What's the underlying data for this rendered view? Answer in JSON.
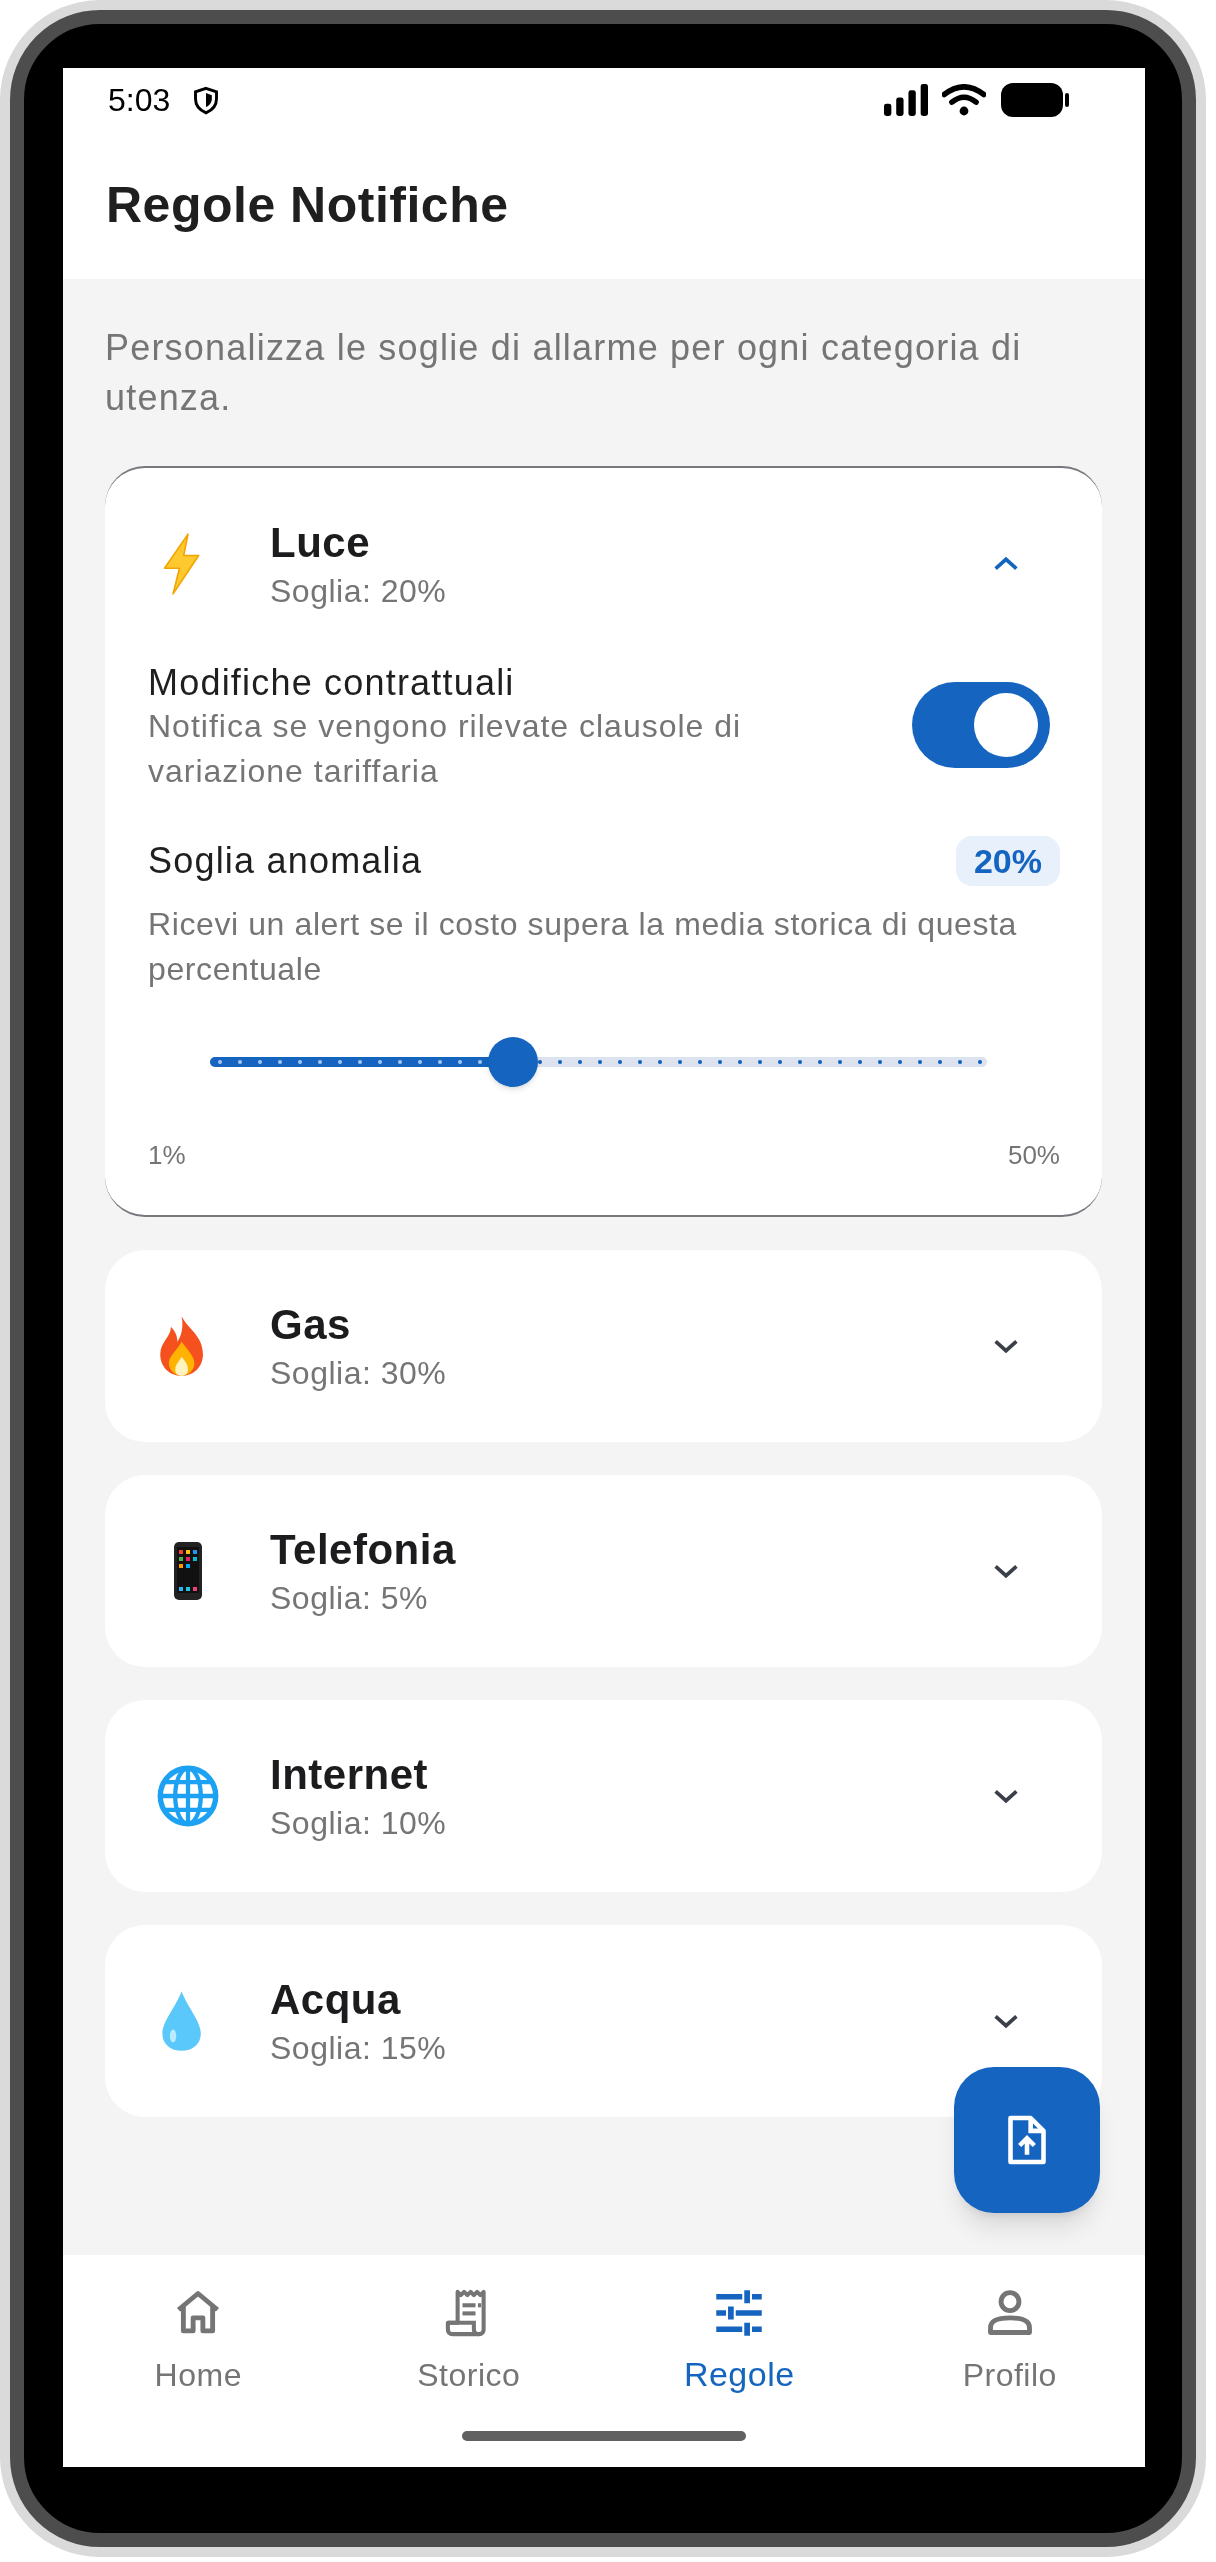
{
  "status_bar": {
    "time": "5:03"
  },
  "app_bar": {
    "title": "Regole Notifiche"
  },
  "description": "Personalizza le soglie di allarme per ogni categoria di utenza.",
  "categories": [
    {
      "kind": "electricity",
      "name": "Luce",
      "threshold": "Soglia: 20%",
      "expanded": true,
      "contract_changes": {
        "title": "Modifiche contrattuali",
        "description": "Notifica se vengono rilevate clausole di variazione tariffaria",
        "on": true
      },
      "anomaly": {
        "title": "Soglia anomalia",
        "badge": "20%",
        "description": "Ricevi un alert se il costo supera la media storica di questa percentuale",
        "level": 0.39,
        "min_label": "1%",
        "max_label": "50%"
      }
    },
    {
      "kind": "gas",
      "name": "Gas",
      "threshold": "Soglia: 30%",
      "expanded": false
    },
    {
      "kind": "phone",
      "name": "Telefonia",
      "threshold": "Soglia: 5%",
      "expanded": false
    },
    {
      "kind": "internet",
      "name": "Internet",
      "threshold": "Soglia: 10%",
      "expanded": false
    },
    {
      "kind": "water",
      "name": "Acqua",
      "threshold": "Soglia: 15%",
      "expanded": false
    }
  ],
  "bottom_nav": [
    {
      "kind": "home",
      "label": "Home",
      "selected": false
    },
    {
      "kind": "history",
      "label": "Storico",
      "selected": false
    },
    {
      "kind": "rules",
      "label": "Regole",
      "selected": true
    },
    {
      "kind": "profile",
      "label": "Profilo",
      "selected": false
    }
  ]
}
